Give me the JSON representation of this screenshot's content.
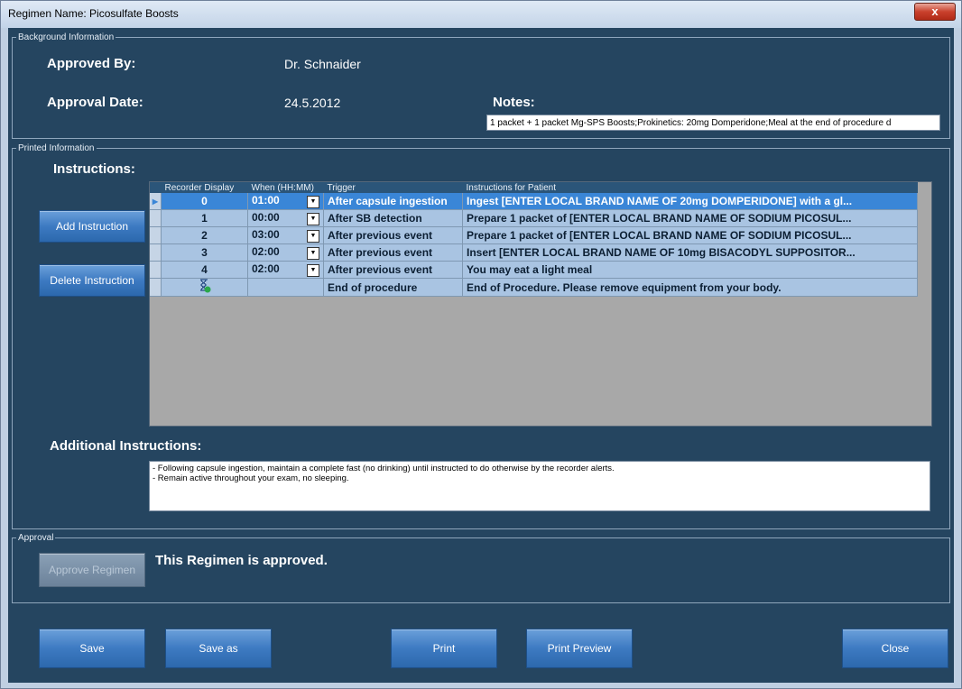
{
  "window": {
    "title": "Regimen Name: Picosulfate Boosts",
    "close_label": "x"
  },
  "background": {
    "legend": "Background Information",
    "approved_by_label": "Approved By:",
    "approved_by_value": "Dr. Schnaider",
    "approval_date_label": "Approval Date:",
    "approval_date_value": "24.5.2012",
    "notes_label": "Notes:",
    "notes_value": "1 packet + 1 packet Mg-SPS Boosts;Prokinetics: 20mg Domperidone;Meal at the end of procedure d"
  },
  "printed": {
    "legend": "Printed Information",
    "instructions_label": "Instructions:",
    "add_button": "Add Instruction",
    "delete_button": "Delete Instruction",
    "columns": [
      "Recorder Display",
      "When (HH:MM)",
      "Trigger",
      "Instructions for Patient"
    ],
    "rows": [
      {
        "display": "0",
        "when": "01:00",
        "trigger": "After capsule ingestion",
        "text": "Ingest [ENTER LOCAL BRAND NAME OF 20mg DOMPERIDONE] with a gl..."
      },
      {
        "display": "1",
        "when": "00:00",
        "trigger": "After SB detection",
        "text": "Prepare 1 packet of [ENTER LOCAL BRAND NAME OF SODIUM PICOSUL..."
      },
      {
        "display": "2",
        "when": "03:00",
        "trigger": "After previous event",
        "text": "Prepare 1 packet of [ENTER LOCAL BRAND NAME OF SODIUM PICOSUL..."
      },
      {
        "display": "3",
        "when": "02:00",
        "trigger": "After previous event",
        "text": "Insert [ENTER LOCAL BRAND NAME OF 10mg BISACODYL SUPPOSITOR..."
      },
      {
        "display": "4",
        "when": "02:00",
        "trigger": "After previous event",
        "text": "You may eat a light meal"
      },
      {
        "display": "",
        "when": "",
        "trigger": "End of procedure",
        "text": "End of Procedure. Please remove equipment from your body."
      }
    ],
    "additional_label": "Additional Instructions:",
    "additional_lines": [
      "- Following capsule ingestion, maintain a complete fast (no drinking) until instructed to do otherwise by the recorder alerts.",
      "- Remain active throughout your exam, no sleeping."
    ]
  },
  "approval": {
    "legend": "Approval",
    "approve_button": "Approve Regimen",
    "status": "This Regimen is approved."
  },
  "footer": {
    "save": "Save",
    "save_as": "Save as",
    "print": "Print",
    "print_preview": "Print Preview",
    "close": "Close"
  },
  "colors": {
    "panel": "#254560",
    "button": "#3d7ac2",
    "selected_row": "#3a86d7",
    "row": "#a9c4e2"
  },
  "icons": {
    "end_row_icon": "hourglass-check-icon",
    "dropdown": "chevron-down-icon",
    "row_pointer": "triangle-right-icon"
  }
}
